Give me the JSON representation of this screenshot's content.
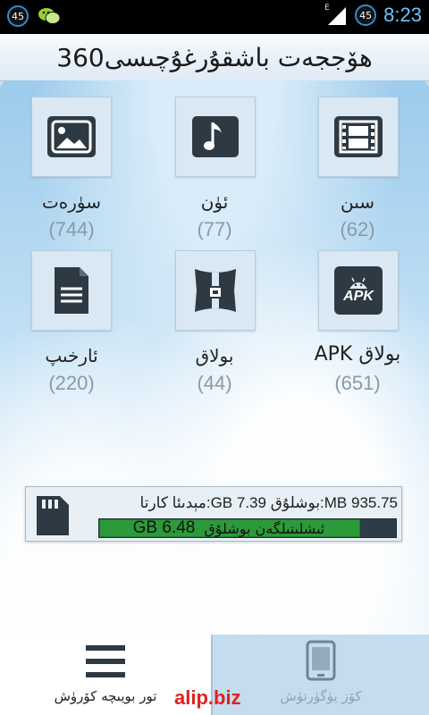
{
  "status_bar": {
    "left_badge": "45",
    "right_badge": "45",
    "network_letter": "E",
    "clock": "8:23"
  },
  "header": {
    "title": "360ھۆججەت باشقۇرغۇچىسى"
  },
  "categories": [
    {
      "icon": "image-icon",
      "label": "سۈرەت",
      "count": "(744)"
    },
    {
      "icon": "music-note-icon",
      "label": "ئۈن",
      "count": "(77)"
    },
    {
      "icon": "film-icon",
      "label": "سىن",
      "count": "(62)"
    },
    {
      "icon": "document-icon",
      "label": "ئارخىپ",
      "count": "(220)"
    },
    {
      "icon": "package-icon",
      "label": "بولاق",
      "count": "(44)"
    },
    {
      "icon": "apk-icon",
      "apk_text": "APK",
      "label": "APK بولاق",
      "count": "(651)"
    }
  ],
  "storage": {
    "info_line": "مېدىئا كارتا:GB 7.39    بوشلۇق:MB 935.75",
    "used_label": "ئىشلىتىلگەن بوشلۇق",
    "used_value": "GB 6.48",
    "used_fraction": 0.88,
    "colors": {
      "used": "#2c9a3a",
      "free": "#2d3c47"
    }
  },
  "tabs": {
    "left_label": "تور بويىچە كۆرۈش",
    "right_label": "كۆز يۈگۈرتۈش"
  },
  "watermark": "alip.biz"
}
